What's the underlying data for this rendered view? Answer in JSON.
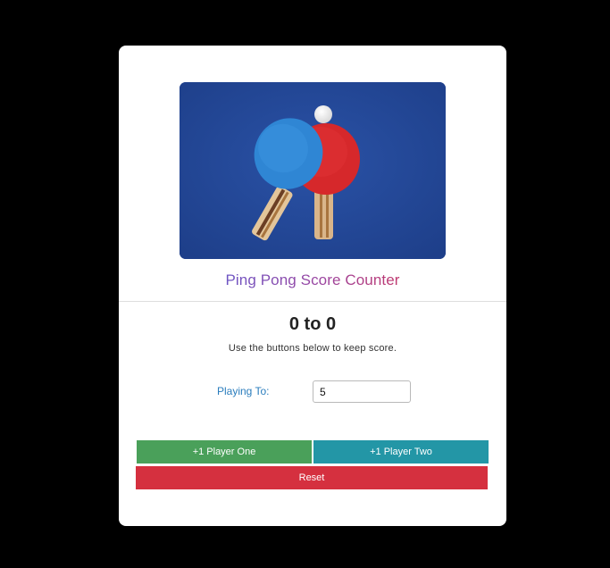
{
  "app": {
    "title": "Ping Pong Score Counter",
    "score_text": "0 to 0",
    "hint": "Use the buttons below to keep score."
  },
  "settings": {
    "playing_to_label": "Playing To:",
    "playing_to_value": "5"
  },
  "buttons": {
    "player_one": "+1 Player One",
    "player_two": "+1 Player Two",
    "reset": "Reset"
  },
  "colors": {
    "player_one": "#4aa05a",
    "player_two": "#2396a6",
    "reset": "#d5303f",
    "label": "#2a7dbd",
    "image_background": "#24489a"
  },
  "hero_image": {
    "icon": "ping-pong-paddles-image"
  }
}
